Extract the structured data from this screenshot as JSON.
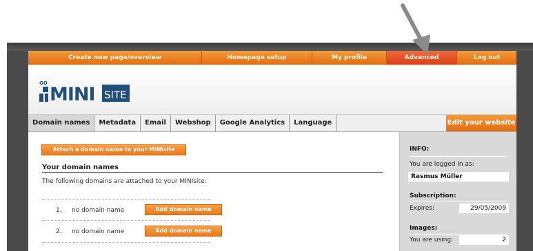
{
  "top_nav": {
    "items": [
      {
        "label": "Create new page/overview"
      },
      {
        "label": "Homepage setup"
      },
      {
        "label": "My profile"
      },
      {
        "label": "Advanced"
      },
      {
        "label": "Log out"
      }
    ]
  },
  "logo": {
    "prefix": "GO",
    "mini": "MINI",
    "site": "SITE"
  },
  "tabs": [
    {
      "label": "Domain names"
    },
    {
      "label": "Metadata"
    },
    {
      "label": "Email"
    },
    {
      "label": "Webshop"
    },
    {
      "label": "Google Analytics"
    },
    {
      "label": "Language"
    }
  ],
  "edit_button": "Edit your website",
  "main": {
    "attach_button": "Attach a domain name to your MINIsite",
    "section_title": "Your domain names",
    "description": "The following domains are attached to your MINIsite:",
    "domains": [
      {
        "num": "1.",
        "name": "no domain name",
        "button": "Add domain name"
      },
      {
        "num": "2.",
        "name": "no domain name",
        "button": "Add domain name"
      }
    ]
  },
  "sidebar": {
    "info_title": "INFO:",
    "logged_in_label": "You are logged in as:",
    "user_name": "Rasmus Müller",
    "subscription_title": "Subscription:",
    "expires_label": "Expires:",
    "expires_value": "29/05/2009",
    "images_title": "Images:",
    "using_label": "You are using:",
    "using_value": "2"
  },
  "colors": {
    "accent": "#e8791c",
    "active_nav": "#d8401a",
    "sidebar": "#d9d9d9",
    "logo_blue": "#1f4f7a"
  },
  "annotation": {
    "icon": "down-arrow-icon"
  }
}
